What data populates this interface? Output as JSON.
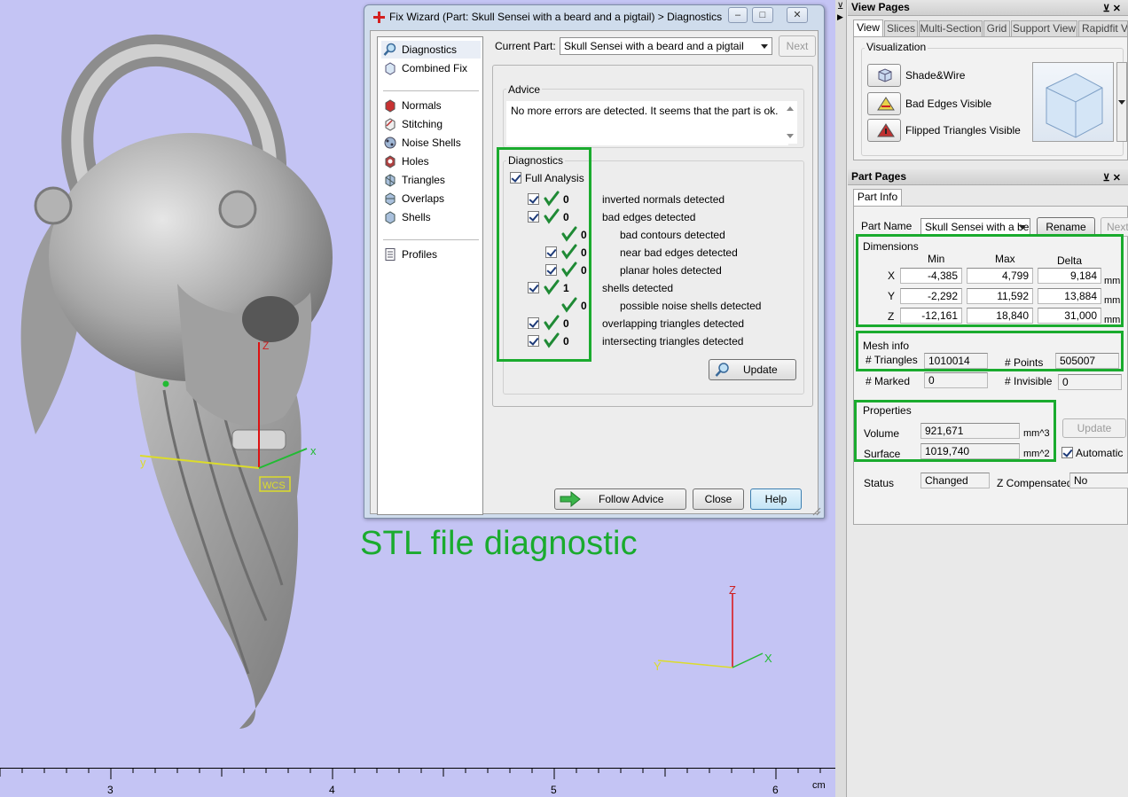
{
  "viewport": {
    "annotation": "STL file diagnostic",
    "ruler": {
      "labels": [
        "3",
        "4",
        "5",
        "6"
      ],
      "unit": "cm"
    },
    "part_axes": {
      "z": "Z",
      "y": "y",
      "x": "x",
      "wcs": "WCS"
    },
    "world_axes": {
      "z": "Z",
      "y": "Y",
      "x": "X"
    },
    "colors": {
      "background": "#c4c4f4",
      "annotation": "#1aab2e"
    }
  },
  "dialog": {
    "title": "Fix Wizard (Part: Skull Sensei with a beard and a pigtail) > Diagnostics",
    "window_buttons": [
      "minimize",
      "maximize",
      "close"
    ],
    "nav": [
      {
        "label": "Diagnostics",
        "icon": "magnifier-icon",
        "selected": true
      },
      {
        "label": "Combined Fix",
        "icon": "combined-fix-icon"
      },
      {
        "label": "Normals",
        "icon": "normals-icon"
      },
      {
        "label": "Stitching",
        "icon": "stitching-icon"
      },
      {
        "label": "Noise Shells",
        "icon": "noise-shells-icon"
      },
      {
        "label": "Holes",
        "icon": "holes-icon"
      },
      {
        "label": "Triangles",
        "icon": "triangles-icon"
      },
      {
        "label": "Overlaps",
        "icon": "overlaps-icon"
      },
      {
        "label": "Shells",
        "icon": "shells-icon"
      },
      {
        "label": "Profiles",
        "icon": "profiles-icon"
      }
    ],
    "current_part_label": "Current Part:",
    "current_part_value": "Skull Sensei with a beard and a pigtail",
    "next_label": "Next",
    "advice_title": "Advice",
    "advice_text": "No more errors are detected. It seems that the part is ok.",
    "diagnostics_title": "Diagnostics",
    "full_analysis_label": "Full Analysis",
    "rows": [
      {
        "checkbox": true,
        "count": "0",
        "text": "inverted normals detected",
        "level": 0
      },
      {
        "checkbox": true,
        "count": "0",
        "text": "bad edges detected",
        "level": 0
      },
      {
        "checkbox": false,
        "count": "0",
        "text": "bad contours detected",
        "level": 1
      },
      {
        "checkbox": true,
        "count": "0",
        "text": "near bad edges detected",
        "level": 1
      },
      {
        "checkbox": true,
        "count": "0",
        "text": "planar holes detected",
        "level": 1
      },
      {
        "checkbox": true,
        "count": "1",
        "text": "shells detected",
        "level": 0
      },
      {
        "checkbox": false,
        "count": "0",
        "text": "possible noise shells detected",
        "level": 1
      },
      {
        "checkbox": true,
        "count": "0",
        "text": "overlapping triangles detected",
        "level": 0
      },
      {
        "checkbox": true,
        "count": "0",
        "text": "intersecting triangles detected",
        "level": 0
      }
    ],
    "update_label": "Update",
    "follow_advice_label": "Follow Advice",
    "close_label": "Close",
    "help_label": "Help"
  },
  "view_pages": {
    "title": "View Pages",
    "tabs": [
      "View",
      "Slices",
      "Multi-Section",
      "Grid",
      "Support View",
      "Rapidfit View"
    ],
    "active_tab": "View",
    "visualization_title": "Visualization",
    "buttons": [
      "Shade&Wire",
      "Bad Edges Visible",
      "Flipped Triangles Visible"
    ]
  },
  "part_pages": {
    "title": "Part Pages",
    "tab": "Part Info",
    "part_name_label": "Part Name",
    "part_name_value": "Skull Sensei with a be",
    "rename_label": "Rename",
    "next_label": "Next",
    "dimensions": {
      "title": "Dimensions",
      "columns": [
        "Min",
        "Max",
        "Delta"
      ],
      "unit": "mm",
      "rows": [
        {
          "axis": "X",
          "min": "-4,385",
          "max": "4,799",
          "delta": "9,184"
        },
        {
          "axis": "Y",
          "min": "-2,292",
          "max": "11,592",
          "delta": "13,884"
        },
        {
          "axis": "Z",
          "min": "-12,161",
          "max": "18,840",
          "delta": "31,000"
        }
      ]
    },
    "mesh_info": {
      "title": "Mesh info",
      "triangles_label": "# Triangles",
      "triangles": "1010014",
      "points_label": "# Points",
      "points": "505007",
      "marked_label": "# Marked",
      "marked": "0",
      "invisible_label": "# Invisible",
      "invisible": "0"
    },
    "properties": {
      "title": "Properties",
      "volume_label": "Volume",
      "volume": "921,671",
      "volume_unit": "mm^3",
      "surface_label": "Surface",
      "surface": "1019,740",
      "surface_unit": "mm^2",
      "update_label": "Update",
      "automatic_label": "Automatic"
    },
    "status_label": "Status",
    "status_value": "Changed",
    "zcomp_label": "Z Compensated",
    "zcomp_value": "No"
  },
  "accent": "#1aab2e"
}
